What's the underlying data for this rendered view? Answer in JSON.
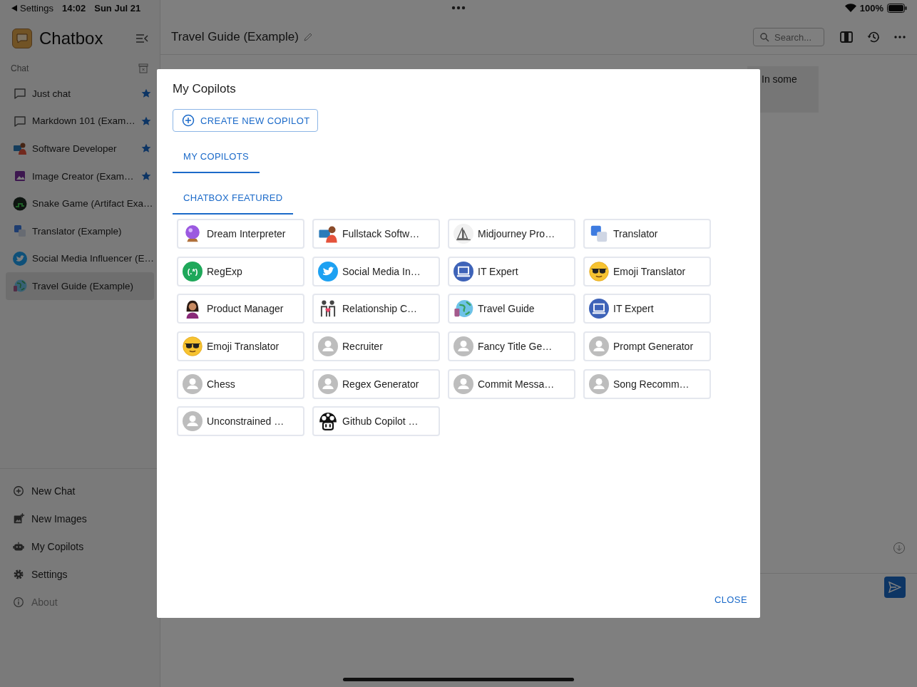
{
  "status_bar": {
    "back_label": "Settings",
    "time": "14:02",
    "date": "Sun Jul 21",
    "battery": "100%"
  },
  "sidebar": {
    "app_name": "Chatbox",
    "section_label": "Chat",
    "items": [
      {
        "label": "Just chat",
        "kind": "chat",
        "starred": true,
        "selected": false
      },
      {
        "label": "Markdown 101 (Exam…",
        "kind": "chat",
        "starred": true,
        "selected": false
      },
      {
        "label": "Software Developer",
        "kind": "developer",
        "starred": true,
        "selected": false
      },
      {
        "label": "Image Creator (Exam…",
        "kind": "image",
        "starred": true,
        "selected": false
      },
      {
        "label": "Snake Game (Artifact Exa…",
        "kind": "snake",
        "starred": false,
        "selected": false
      },
      {
        "label": "Translator (Example)",
        "kind": "translate",
        "starred": false,
        "selected": false
      },
      {
        "label": "Social Media Influencer (E…",
        "kind": "bird",
        "starred": false,
        "selected": false
      },
      {
        "label": "Travel Guide (Example)",
        "kind": "globe",
        "starred": false,
        "selected": true
      }
    ],
    "menu": [
      {
        "label": "New Chat",
        "kind": "plus-circle",
        "disabled": false
      },
      {
        "label": "New Images",
        "kind": "image-plus",
        "disabled": false
      },
      {
        "label": "My Copilots",
        "kind": "robot",
        "disabled": false
      },
      {
        "label": "Settings",
        "kind": "gear",
        "disabled": false
      },
      {
        "label": "About",
        "kind": "info",
        "disabled": true
      }
    ]
  },
  "main": {
    "title": "Travel Guide (Example)",
    "search": {
      "placeholder": "Search..."
    },
    "message_excerpt": "In some"
  },
  "dialog": {
    "title": "My Copilots",
    "create_button": "CREATE NEW COPILOT",
    "tabs": [
      {
        "label": "MY COPILOTS",
        "selected": true
      },
      {
        "label": "CHATBOX FEATURED",
        "selected": true
      }
    ],
    "copilots": [
      {
        "name": "Dream Interpreter",
        "kind": "crystal-ball"
      },
      {
        "name": "Fullstack Softw…",
        "kind": "developer"
      },
      {
        "name": "Midjourney Pro…",
        "kind": "sailboat"
      },
      {
        "name": "Translator",
        "kind": "translate"
      },
      {
        "name": "RegExp",
        "kind": "regex",
        "avatar_text": "(.*)"
      },
      {
        "name": "Social Media In…",
        "kind": "bird"
      },
      {
        "name": "IT Expert",
        "kind": "laptop"
      },
      {
        "name": "Emoji Translator",
        "kind": "sunglasses"
      },
      {
        "name": "Product Manager",
        "kind": "woman"
      },
      {
        "name": "Relationship C…",
        "kind": "couple"
      },
      {
        "name": "Travel Guide",
        "kind": "globe"
      },
      {
        "name": "IT Expert",
        "kind": "laptop"
      },
      {
        "name": "Emoji Translator",
        "kind": "sunglasses"
      },
      {
        "name": "Recruiter",
        "kind": "person"
      },
      {
        "name": "Fancy Title Ge…",
        "kind": "person"
      },
      {
        "name": "Prompt Generator",
        "kind": "person"
      },
      {
        "name": "Chess",
        "kind": "person"
      },
      {
        "name": "Regex Generator",
        "kind": "person"
      },
      {
        "name": "Commit Messa…",
        "kind": "person"
      },
      {
        "name": "Song Recomm…",
        "kind": "person"
      },
      {
        "name": "Unconstrained …",
        "kind": "person"
      },
      {
        "name": "Github Copilot …",
        "kind": "mushroom"
      }
    ],
    "close_button": "CLOSE"
  }
}
